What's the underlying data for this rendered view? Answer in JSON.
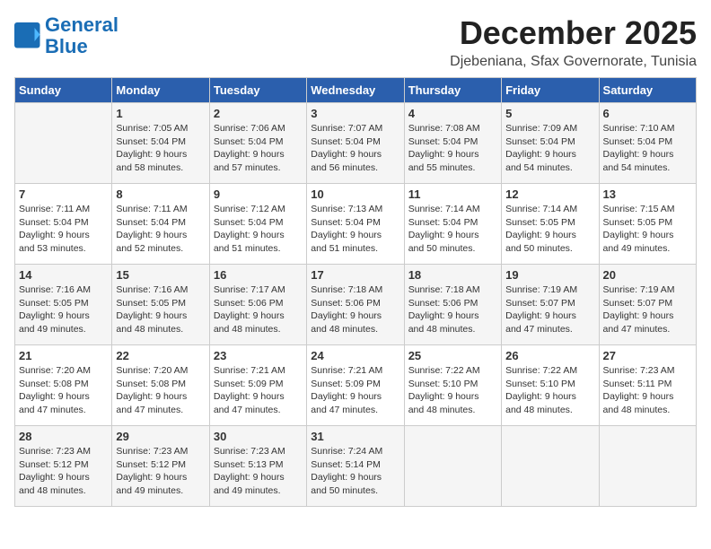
{
  "header": {
    "logo_general": "General",
    "logo_blue": "Blue",
    "title": "December 2025",
    "location": "Djebeniana, Sfax Governorate, Tunisia"
  },
  "days_of_week": [
    "Sunday",
    "Monday",
    "Tuesday",
    "Wednesday",
    "Thursday",
    "Friday",
    "Saturday"
  ],
  "weeks": [
    [
      {
        "day": "",
        "info": ""
      },
      {
        "day": "1",
        "info": "Sunrise: 7:05 AM\nSunset: 5:04 PM\nDaylight: 9 hours\nand 58 minutes."
      },
      {
        "day": "2",
        "info": "Sunrise: 7:06 AM\nSunset: 5:04 PM\nDaylight: 9 hours\nand 57 minutes."
      },
      {
        "day": "3",
        "info": "Sunrise: 7:07 AM\nSunset: 5:04 PM\nDaylight: 9 hours\nand 56 minutes."
      },
      {
        "day": "4",
        "info": "Sunrise: 7:08 AM\nSunset: 5:04 PM\nDaylight: 9 hours\nand 55 minutes."
      },
      {
        "day": "5",
        "info": "Sunrise: 7:09 AM\nSunset: 5:04 PM\nDaylight: 9 hours\nand 54 minutes."
      },
      {
        "day": "6",
        "info": "Sunrise: 7:10 AM\nSunset: 5:04 PM\nDaylight: 9 hours\nand 54 minutes."
      }
    ],
    [
      {
        "day": "7",
        "info": "Sunrise: 7:11 AM\nSunset: 5:04 PM\nDaylight: 9 hours\nand 53 minutes."
      },
      {
        "day": "8",
        "info": "Sunrise: 7:11 AM\nSunset: 5:04 PM\nDaylight: 9 hours\nand 52 minutes."
      },
      {
        "day": "9",
        "info": "Sunrise: 7:12 AM\nSunset: 5:04 PM\nDaylight: 9 hours\nand 51 minutes."
      },
      {
        "day": "10",
        "info": "Sunrise: 7:13 AM\nSunset: 5:04 PM\nDaylight: 9 hours\nand 51 minutes."
      },
      {
        "day": "11",
        "info": "Sunrise: 7:14 AM\nSunset: 5:04 PM\nDaylight: 9 hours\nand 50 minutes."
      },
      {
        "day": "12",
        "info": "Sunrise: 7:14 AM\nSunset: 5:05 PM\nDaylight: 9 hours\nand 50 minutes."
      },
      {
        "day": "13",
        "info": "Sunrise: 7:15 AM\nSunset: 5:05 PM\nDaylight: 9 hours\nand 49 minutes."
      }
    ],
    [
      {
        "day": "14",
        "info": "Sunrise: 7:16 AM\nSunset: 5:05 PM\nDaylight: 9 hours\nand 49 minutes."
      },
      {
        "day": "15",
        "info": "Sunrise: 7:16 AM\nSunset: 5:05 PM\nDaylight: 9 hours\nand 48 minutes."
      },
      {
        "day": "16",
        "info": "Sunrise: 7:17 AM\nSunset: 5:06 PM\nDaylight: 9 hours\nand 48 minutes."
      },
      {
        "day": "17",
        "info": "Sunrise: 7:18 AM\nSunset: 5:06 PM\nDaylight: 9 hours\nand 48 minutes."
      },
      {
        "day": "18",
        "info": "Sunrise: 7:18 AM\nSunset: 5:06 PM\nDaylight: 9 hours\nand 48 minutes."
      },
      {
        "day": "19",
        "info": "Sunrise: 7:19 AM\nSunset: 5:07 PM\nDaylight: 9 hours\nand 47 minutes."
      },
      {
        "day": "20",
        "info": "Sunrise: 7:19 AM\nSunset: 5:07 PM\nDaylight: 9 hours\nand 47 minutes."
      }
    ],
    [
      {
        "day": "21",
        "info": "Sunrise: 7:20 AM\nSunset: 5:08 PM\nDaylight: 9 hours\nand 47 minutes."
      },
      {
        "day": "22",
        "info": "Sunrise: 7:20 AM\nSunset: 5:08 PM\nDaylight: 9 hours\nand 47 minutes."
      },
      {
        "day": "23",
        "info": "Sunrise: 7:21 AM\nSunset: 5:09 PM\nDaylight: 9 hours\nand 47 minutes."
      },
      {
        "day": "24",
        "info": "Sunrise: 7:21 AM\nSunset: 5:09 PM\nDaylight: 9 hours\nand 47 minutes."
      },
      {
        "day": "25",
        "info": "Sunrise: 7:22 AM\nSunset: 5:10 PM\nDaylight: 9 hours\nand 48 minutes."
      },
      {
        "day": "26",
        "info": "Sunrise: 7:22 AM\nSunset: 5:10 PM\nDaylight: 9 hours\nand 48 minutes."
      },
      {
        "day": "27",
        "info": "Sunrise: 7:23 AM\nSunset: 5:11 PM\nDaylight: 9 hours\nand 48 minutes."
      }
    ],
    [
      {
        "day": "28",
        "info": "Sunrise: 7:23 AM\nSunset: 5:12 PM\nDaylight: 9 hours\nand 48 minutes."
      },
      {
        "day": "29",
        "info": "Sunrise: 7:23 AM\nSunset: 5:12 PM\nDaylight: 9 hours\nand 49 minutes."
      },
      {
        "day": "30",
        "info": "Sunrise: 7:23 AM\nSunset: 5:13 PM\nDaylight: 9 hours\nand 49 minutes."
      },
      {
        "day": "31",
        "info": "Sunrise: 7:24 AM\nSunset: 5:14 PM\nDaylight: 9 hours\nand 50 minutes."
      },
      {
        "day": "",
        "info": ""
      },
      {
        "day": "",
        "info": ""
      },
      {
        "day": "",
        "info": ""
      }
    ]
  ]
}
